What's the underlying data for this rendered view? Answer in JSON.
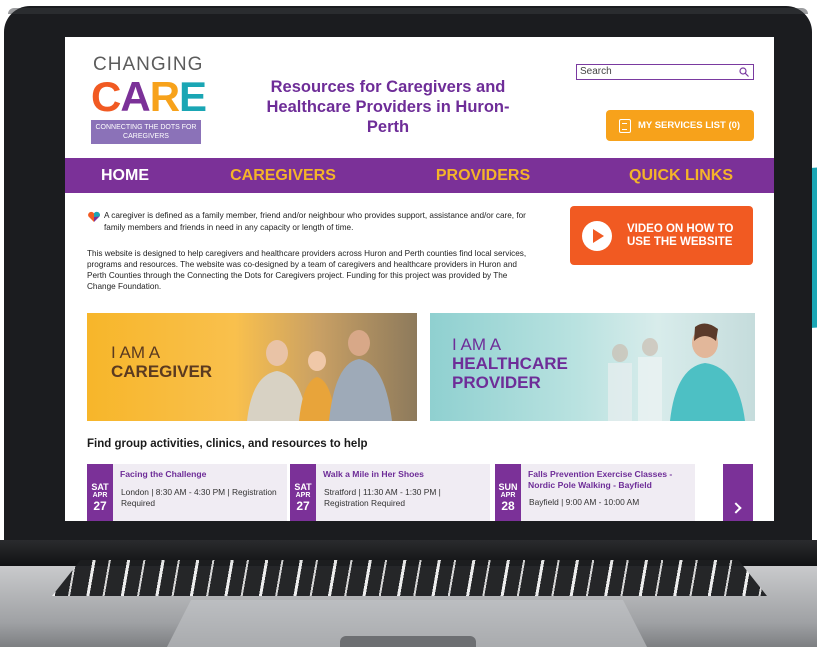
{
  "logo": {
    "top": "CHANGING",
    "care_letters": [
      "C",
      "A",
      "R",
      "E"
    ],
    "care_colors": [
      "#f15a22",
      "#7b3198",
      "#f7a21b",
      "#1aa6b4"
    ],
    "subtitle": "CONNECTING THE DOTS FOR CAREGIVERS"
  },
  "header": {
    "title": "Resources for Caregivers and Healthcare Providers in Huron-Perth",
    "search_placeholder": "Search",
    "services_button": "MY SERVICES LIST (0)"
  },
  "nav": {
    "home": "HOME",
    "caregivers": "CAREGIVERS",
    "providers": "PROVIDERS",
    "quick_links": "QUICK LINKS"
  },
  "intro": {
    "definition": "A caregiver is defined as a family member, friend and/or neighbour who provides support, assistance and/or care, for family members and friends in need in any capacity or length of time.",
    "description": "This website is designed to help caregivers and healthcare providers across Huron and Perth counties find local services, programs and resources. The website was co-designed by a team of caregivers and healthcare providers in Huron and Perth Counties through the Connecting the Dots for Caregivers project. Funding for this project was provided by The Change Foundation."
  },
  "video_button": "VIDEO ON HOW TO USE THE WEBSITE",
  "banners": {
    "caregiver": {
      "line1": "I AM A",
      "line2": "CAREGIVER"
    },
    "provider": {
      "line1": "I AM A",
      "line2": "HEALTHCARE",
      "line3": "PROVIDER"
    }
  },
  "events_title": "Find group activities, clinics, and resources to help",
  "events": [
    {
      "dow": "SAT",
      "month": "APR",
      "day": "27",
      "title": "Facing the Challenge",
      "info": "London | 8:30 AM - 4:30 PM | Registration Required"
    },
    {
      "dow": "SAT",
      "month": "APR",
      "day": "27",
      "title": "Walk a Mile in Her Shoes",
      "info": "Stratford | 11:30 AM - 1:30 PM | Registration Required"
    },
    {
      "dow": "SUN",
      "month": "APR",
      "day": "28",
      "title": "Falls Prevention Exercise Classes - Nordic Pole Walking - Bayfield",
      "info": "Bayfield | 9:00 AM - 10:00 AM"
    }
  ],
  "colors": {
    "purple": "#7b3198",
    "orange": "#f15a22",
    "gold": "#f7a21b",
    "teal": "#1aa6b4"
  }
}
